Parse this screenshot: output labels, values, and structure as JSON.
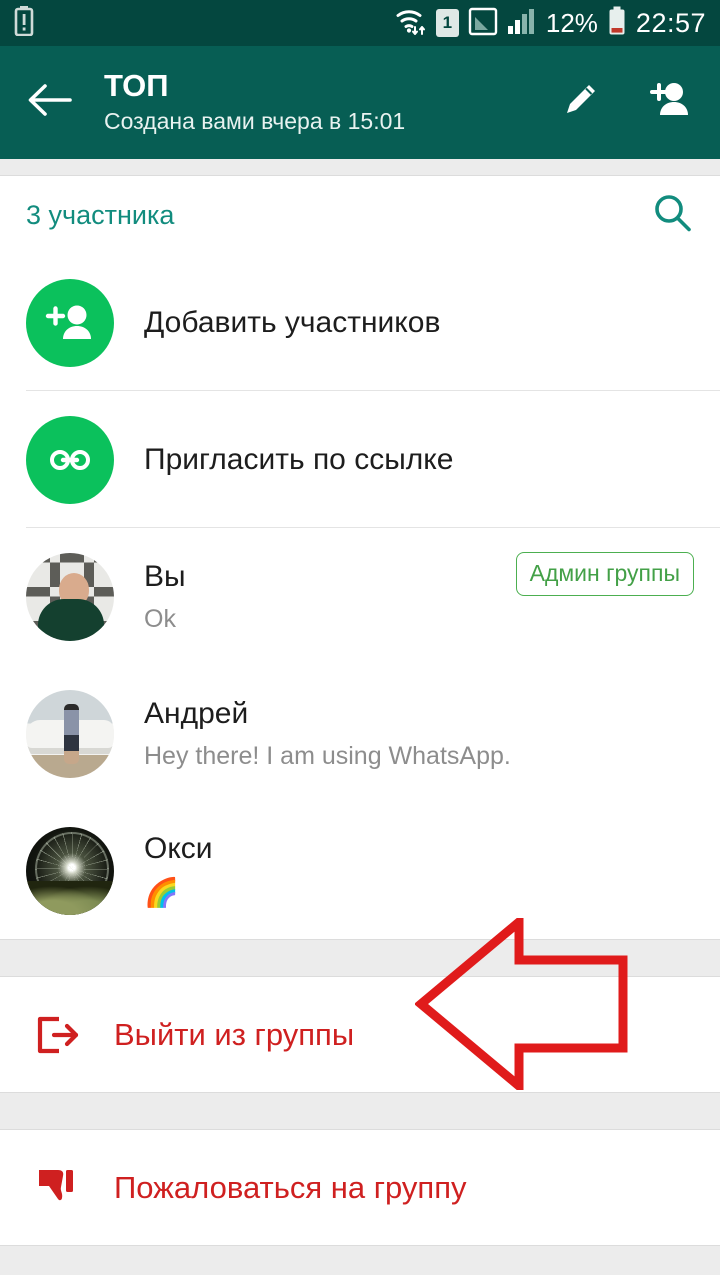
{
  "statusbar": {
    "battery_warning_icon": "battery-alert-icon",
    "wifi_icon": "wifi-transfer-icon",
    "sim_label": "1",
    "signal_icon_1": "signal-weak-icon",
    "signal_icon_2": "signal-bars-icon",
    "battery_percent": "12%",
    "battery_icon": "battery-low-icon",
    "time": "22:57",
    "bg_color": "#04473f"
  },
  "appbar": {
    "back_icon": "back-arrow-icon",
    "title": "ТОП",
    "subtitle": "Создана вами вчера в 15:01",
    "edit_icon": "pencil-icon",
    "add_member_icon": "add-person-icon",
    "bg_color": "#075e54"
  },
  "participants_section": {
    "count_label": "3 участника",
    "count_color": "#128c7e",
    "search_icon": "search-icon"
  },
  "actions": [
    {
      "icon": "add-person-icon",
      "label": "Добавить участников",
      "circle_color": "#0bc15c"
    },
    {
      "icon": "link-icon",
      "label": "Пригласить по ссылке",
      "circle_color": "#0bc15c"
    }
  ],
  "members": [
    {
      "avatar": "avatar-you",
      "name": "Вы",
      "status": "Ok",
      "badge": "Админ группы",
      "badge_color": "#43a047"
    },
    {
      "avatar": "avatar-andrey",
      "name": "Андрей",
      "status": "Hey there! I am using WhatsApp.",
      "badge": ""
    },
    {
      "avatar": "avatar-oksi",
      "name": "Окси",
      "status": "🌈",
      "badge": ""
    }
  ],
  "danger_actions": [
    {
      "icon": "exit-group-icon",
      "label": "Выйти из группы",
      "color": "#cf2020"
    },
    {
      "icon": "thumbs-down-icon",
      "label": "Пожаловаться на группу",
      "color": "#cf2020"
    }
  ],
  "annotation": {
    "type": "arrow-pointing-left",
    "target": "Выйти из группы",
    "color": "#e01b1b"
  }
}
